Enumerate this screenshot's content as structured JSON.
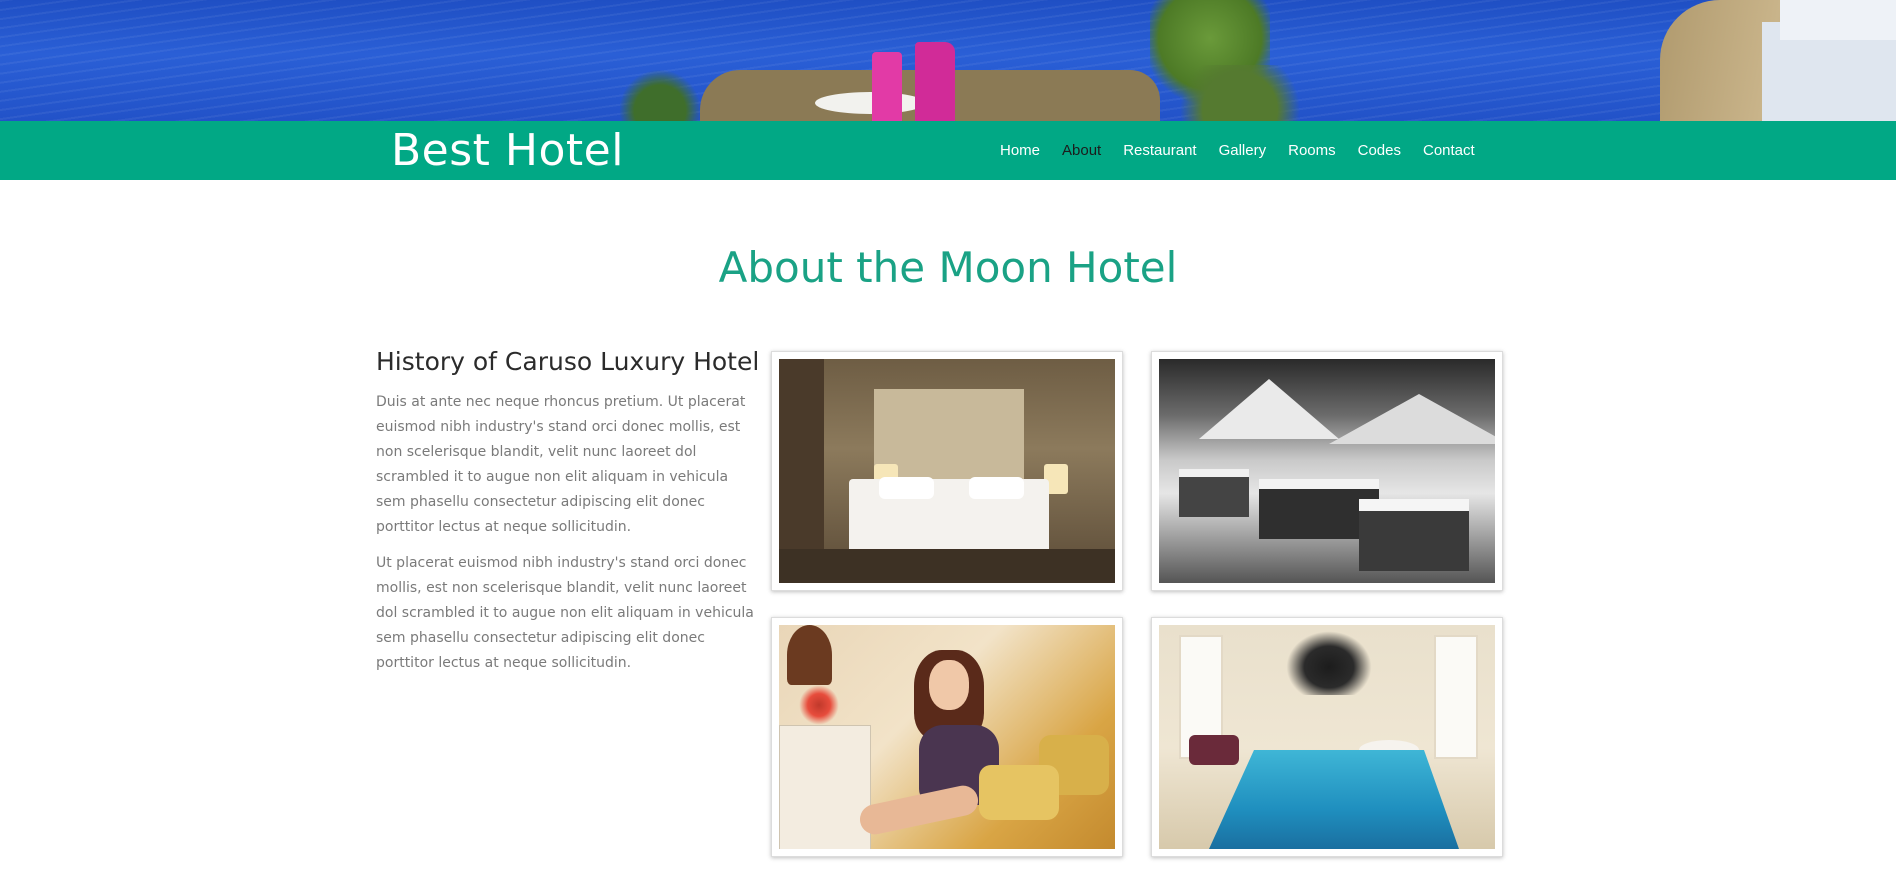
{
  "header": {
    "brand": "Best Hotel",
    "nav": [
      {
        "label": "Home",
        "active": false
      },
      {
        "label": "About",
        "active": true
      },
      {
        "label": "Restaurant",
        "active": false
      },
      {
        "label": "Gallery",
        "active": false
      },
      {
        "label": "Rooms",
        "active": false
      },
      {
        "label": "Codes",
        "active": false
      },
      {
        "label": "Contact",
        "active": false
      }
    ]
  },
  "main": {
    "title": "About the Moon Hotel",
    "history": {
      "heading": "History of Caruso Luxury Hotel",
      "paragraphs": [
        "Duis at ante nec neque rhoncus pretium. Ut placerat euismod nibh industry's stand orci donec mollis, est non scelerisque blandit, velit nunc laoreet dol scrambled it to augue non elit aliquam in vehicula sem phasellu consectetur adipiscing elit donec porttitor lectus at neque sollicitudin.",
        "Ut placerat euismod nibh industry's stand orci donec mollis, est non scelerisque blandit, velit nunc laoreet dol scrambled it to augue non elit aliquam in vehicula sem phasellu consectetur adipiscing elit donec porttitor lectus at neque sollicitudin."
      ]
    },
    "gallery": [
      "hotel-room-photo",
      "snowy-village-photo",
      "woman-with-wine-photo",
      "indoor-pool-photo"
    ]
  },
  "colors": {
    "brand_green": "#01a885",
    "title_green": "#1aa285",
    "nav_active": "#1c1c1c"
  }
}
